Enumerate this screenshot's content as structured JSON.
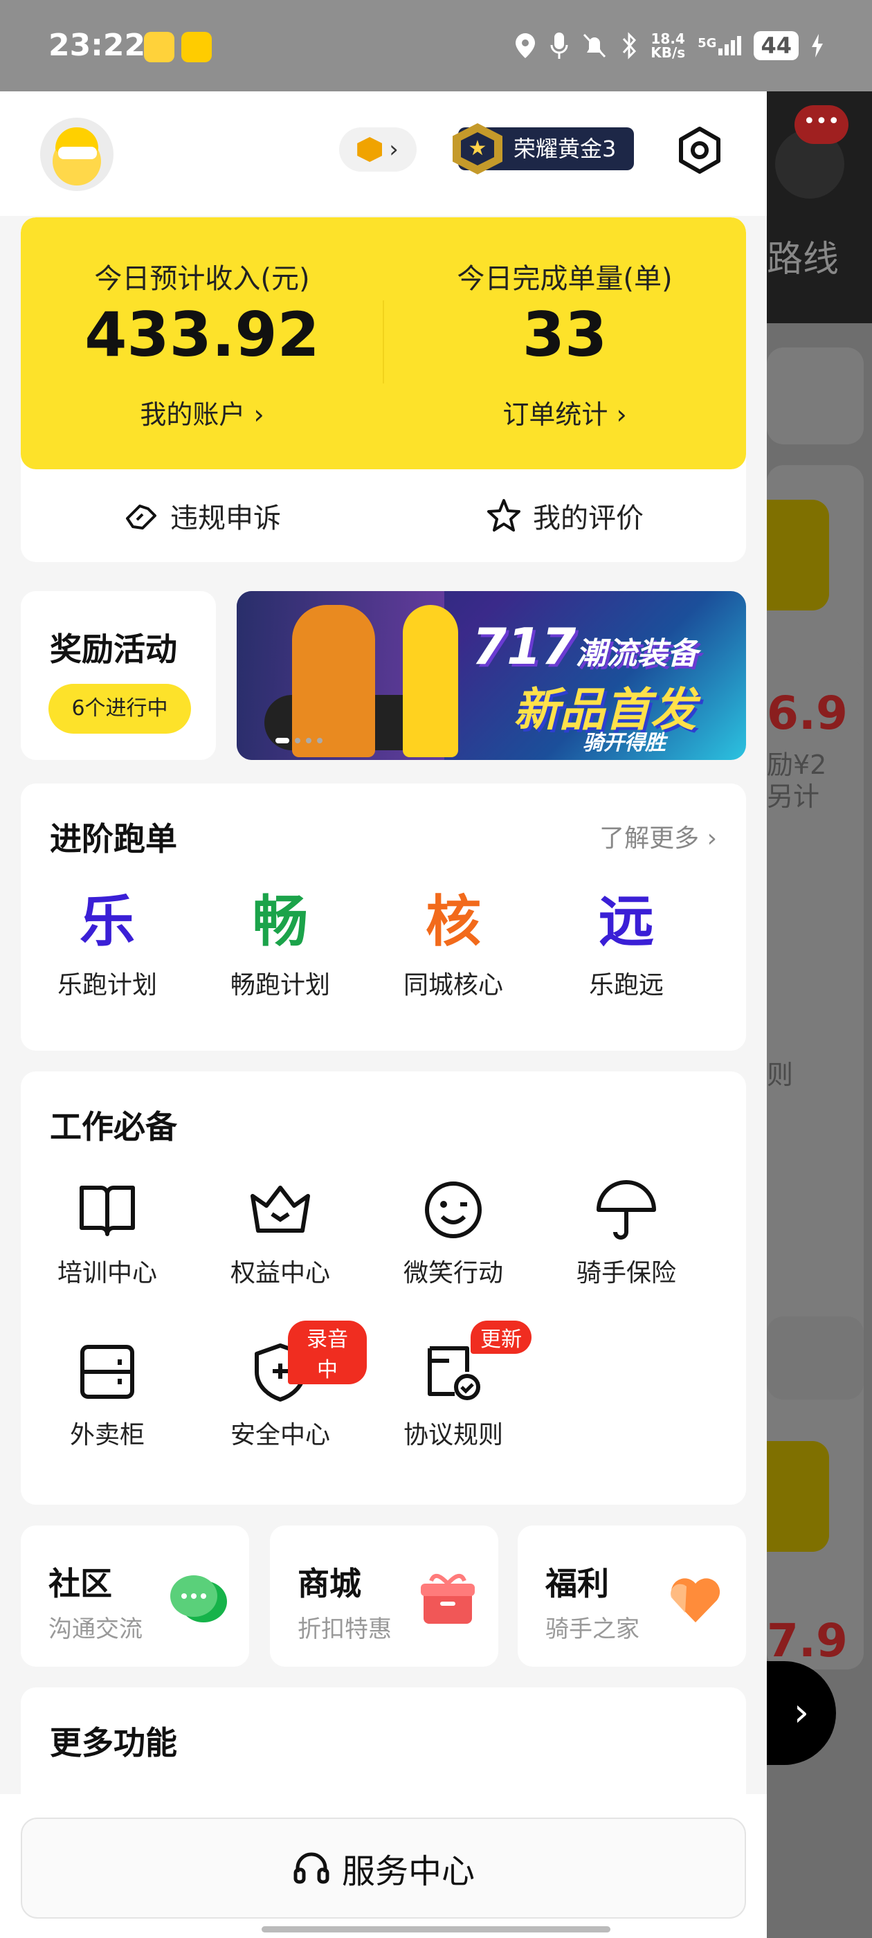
{
  "status_bar": {
    "time": "23:22",
    "net_speed": "18.4",
    "net_unit": "KB/s",
    "network": "5G",
    "battery": "44"
  },
  "header": {
    "rank_label": "荣耀黄金3"
  },
  "income": {
    "earnings_label": "今日预计收入(元)",
    "earnings_value": "433.92",
    "account_link": "我的账户",
    "orders_label": "今日完成单量(单)",
    "orders_value": "33",
    "stats_link": "订单统计",
    "appeal_label": "违规申诉",
    "review_label": "我的评价"
  },
  "rewards": {
    "title": "奖励活动",
    "chip": "6个进行中"
  },
  "banner": {
    "line1_big": "717",
    "line1_small": "潮流装备",
    "line2": "新品首发",
    "line3": "骑开得胜"
  },
  "advanced": {
    "title": "进阶跑单",
    "more": "了解更多",
    "items": [
      {
        "glyph": "乐",
        "label": "乐跑计划",
        "color": "#3a1fd6"
      },
      {
        "glyph": "畅",
        "label": "畅跑计划",
        "color": "#1ba34a"
      },
      {
        "glyph": "核",
        "label": "同城核心",
        "color": "#f26a1b"
      },
      {
        "glyph": "远",
        "label": "乐跑远",
        "color": "#3a1fd6"
      }
    ]
  },
  "work": {
    "title": "工作必备",
    "items": [
      {
        "label": "培训中心",
        "icon": "book-icon"
      },
      {
        "label": "权益中心",
        "icon": "crown-icon"
      },
      {
        "label": "微笑行动",
        "icon": "smile-icon"
      },
      {
        "label": "骑手保险",
        "icon": "umbrella-icon"
      },
      {
        "label": "外卖柜",
        "icon": "locker-icon"
      },
      {
        "label": "安全中心",
        "icon": "shield-icon",
        "badge": "录音中"
      },
      {
        "label": "协议规则",
        "icon": "document-icon",
        "badge": "更新"
      }
    ]
  },
  "mini_cards": [
    {
      "title": "社区",
      "subtitle": "沟通交流",
      "icon": "chat-icon"
    },
    {
      "title": "商城",
      "subtitle": "折扣特惠",
      "icon": "gift-icon"
    },
    {
      "title": "福利",
      "subtitle": "骑手之家",
      "icon": "heart-icon"
    }
  ],
  "more_functions": {
    "title": "更多功能"
  },
  "service": {
    "label": "服务中心"
  },
  "background_app": {
    "route_text": "路线",
    "notify_count": "•••",
    "price1": "6.9",
    "line1": "励¥2",
    "line2": "另计",
    "line3": "则",
    "price2": "7.9"
  },
  "colors": {
    "brand_yellow": "#fde22a",
    "badge_red": "#f02d20"
  }
}
